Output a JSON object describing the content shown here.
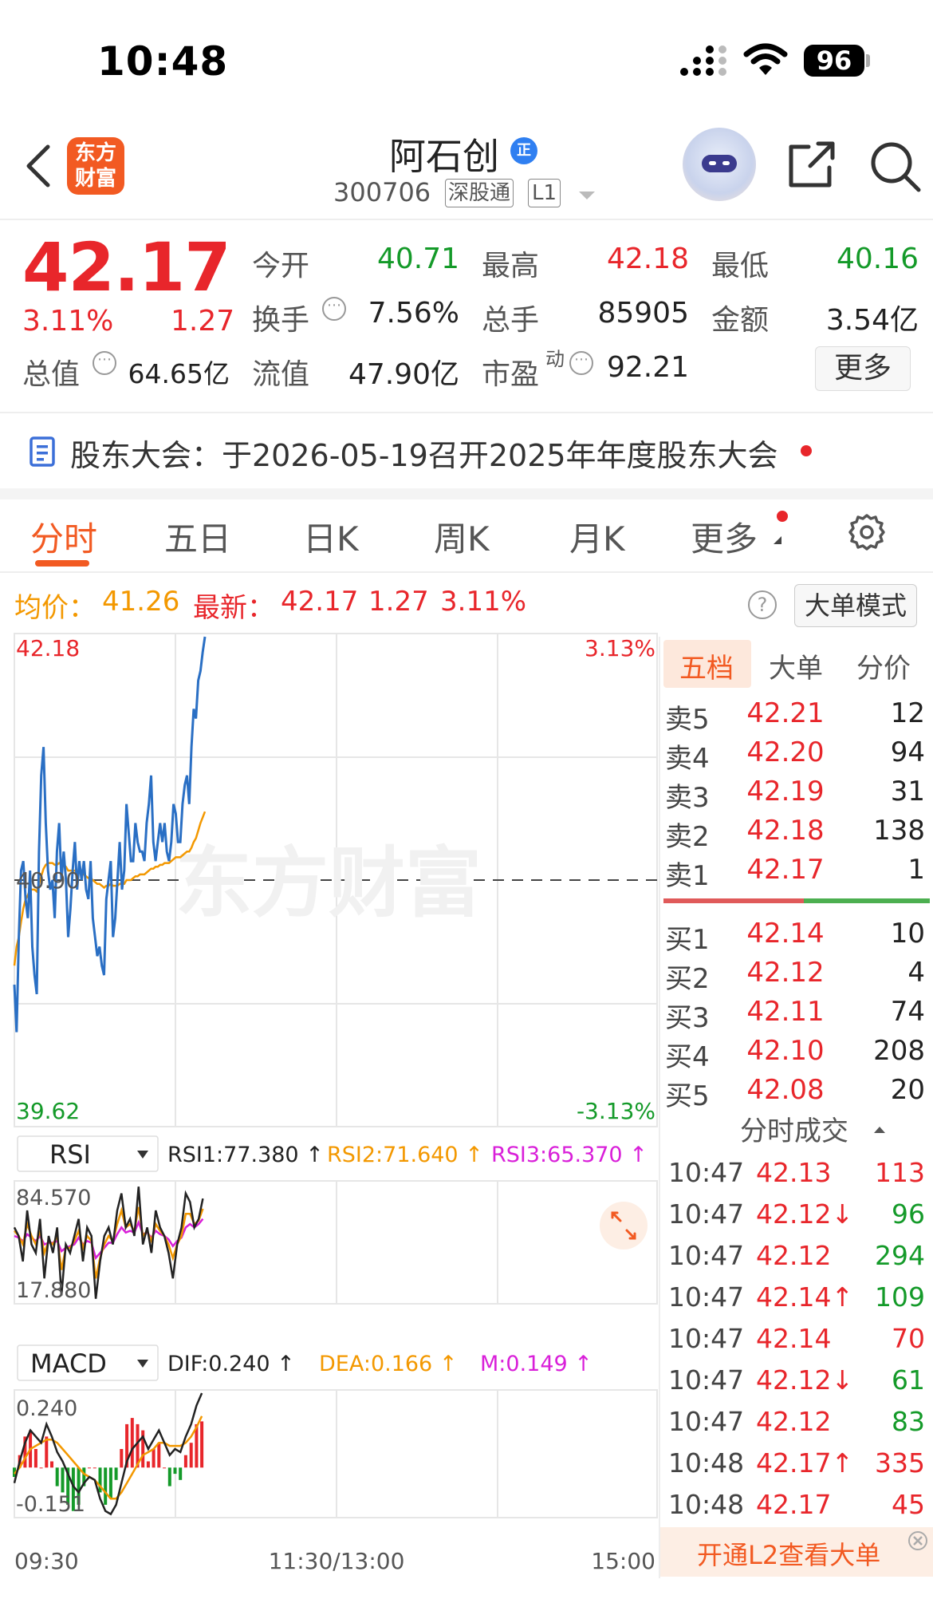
{
  "status": {
    "time": "10:48",
    "battery": "96"
  },
  "header": {
    "logo_line1": "东方",
    "logo_line2": "财富",
    "stock_name": "阿石创",
    "badge": "正",
    "code": "300706",
    "market": "深股通",
    "level": "L1"
  },
  "quote": {
    "price": "42.17",
    "change_pct": "3.11%",
    "change_amt": "1.27",
    "open_label": "今开",
    "open": "40.71",
    "high_label": "最高",
    "high": "42.18",
    "low_label": "最低",
    "low": "40.16",
    "turnover_label": "换手",
    "turnover": "7.56%",
    "volume_label": "总手",
    "volume": "85905",
    "amount_label": "金额",
    "amount": "3.54亿",
    "mktcap_label": "总值",
    "mktcap": "64.65亿",
    "float_label": "流值",
    "float": "47.90亿",
    "pe_label": "市盈",
    "pe_sup": "动",
    "pe": "92.21",
    "more": "更多"
  },
  "announcement": {
    "text": "股东大会：于2026-05-19召开2025年年度股东大会"
  },
  "tabs": [
    "分时",
    "五日",
    "日K",
    "周K",
    "月K",
    "更多"
  ],
  "avg_info": {
    "avg_label": "均价：",
    "avg": "41.26",
    "latest_label": "最新：",
    "latest": "42.17",
    "chg": "1.27",
    "pct": "3.11%",
    "mode_button": "大单模式"
  },
  "chart_data": {
    "type": "line",
    "x_axis_labels": [
      "09:30",
      "11:30/13:00",
      "15:00"
    ],
    "price_max": "42.18",
    "price_min": "39.62",
    "prev_close": "40.90",
    "pct_max": "3.13%",
    "pct_min": "-3.13%",
    "ylim": [
      39.62,
      42.18
    ],
    "colors": {
      "price": "#2a6fc4",
      "avg": "#f39800",
      "up": "#e8262b",
      "down": "#149a29"
    },
    "price_series": [
      40.35,
      40.1,
      40.6,
      40.95,
      41.0,
      40.8,
      40.7,
      40.95,
      40.55,
      40.4,
      40.3,
      41.05,
      41.45,
      41.6,
      41.2,
      40.95,
      40.85,
      40.9,
      40.7,
      41.05,
      41.2,
      40.9,
      41.05,
      40.9,
      40.6,
      40.75,
      40.95,
      41.1,
      40.85,
      41.0,
      40.9,
      41.0,
      40.85,
      40.8,
      41.0,
      40.7,
      40.6,
      40.5,
      40.55,
      40.45,
      40.4,
      40.8,
      40.9,
      41.0,
      40.6,
      40.7,
      40.9,
      41.1,
      40.85,
      40.95,
      41.3,
      41.15,
      41.0,
      41.0,
      41.2,
      41.1,
      41.05,
      41.05,
      41.0,
      41.2,
      41.3,
      41.45,
      41.1,
      41.0,
      41.1,
      41.2,
      41.1,
      41.2,
      41.05,
      41.0,
      41.1,
      41.3,
      41.25,
      41.1,
      41.1,
      41.3,
      41.4,
      41.45,
      41.3,
      41.6,
      41.8,
      41.75,
      41.95,
      42.0,
      42.1,
      42.18
    ],
    "avg_series": [
      40.45,
      40.55,
      40.6,
      40.68,
      40.75,
      40.8,
      40.82,
      40.85,
      40.85,
      40.85,
      40.84,
      40.88,
      40.92,
      40.96,
      40.98,
      40.99,
      40.99,
      40.99,
      40.98,
      40.98,
      40.99,
      40.98,
      40.98,
      40.97,
      40.95,
      40.95,
      40.95,
      40.95,
      40.94,
      40.94,
      40.93,
      40.93,
      40.92,
      40.91,
      40.91,
      40.9,
      40.89,
      40.88,
      40.88,
      40.87,
      40.86,
      40.87,
      40.87,
      40.88,
      40.87,
      40.87,
      40.87,
      40.88,
      40.88,
      40.88,
      40.9,
      40.9,
      40.9,
      40.91,
      40.92,
      40.92,
      40.93,
      40.93,
      40.93,
      40.94,
      40.95,
      40.96,
      40.96,
      40.97,
      40.97,
      40.98,
      40.98,
      40.99,
      40.99,
      40.99,
      41.0,
      41.01,
      41.02,
      41.02,
      41.02,
      41.03,
      41.04,
      41.05,
      41.05,
      41.07,
      41.1,
      41.12,
      41.16,
      41.2,
      41.23,
      41.26
    ],
    "rsi": {
      "selector": "RSI",
      "rsi1_label": "RSI1:77.380 ↑",
      "rsi2_label": "RSI2:71.640 ↑",
      "rsi3_label": "RSI3:65.370 ↑",
      "max": "84.570",
      "min": "17.880",
      "ylim": [
        17.88,
        84.57
      ],
      "rsi1": [
        60,
        55,
        40,
        70,
        50,
        45,
        65,
        30,
        55,
        45,
        60,
        20,
        50,
        45,
        55,
        65,
        40,
        60,
        55,
        18,
        40,
        55,
        60,
        50,
        70,
        80,
        60,
        65,
        55,
        84,
        50,
        60,
        45,
        70,
        60,
        55,
        45,
        30,
        50,
        60,
        80,
        75,
        60,
        65,
        77
      ],
      "rsi2": [
        58,
        55,
        50,
        62,
        55,
        50,
        58,
        45,
        52,
        50,
        55,
        35,
        48,
        48,
        52,
        58,
        48,
        55,
        52,
        30,
        42,
        50,
        55,
        52,
        62,
        70,
        60,
        62,
        58,
        72,
        55,
        58,
        52,
        62,
        58,
        55,
        50,
        42,
        50,
        55,
        68,
        68,
        62,
        64,
        71
      ],
      "rsi3": [
        55,
        54,
        52,
        56,
        54,
        52,
        55,
        50,
        51,
        51,
        52,
        46,
        48,
        49,
        50,
        54,
        50,
        52,
        51,
        42,
        45,
        48,
        51,
        51,
        56,
        60,
        57,
        58,
        57,
        63,
        56,
        57,
        54,
        58,
        56,
        55,
        53,
        49,
        52,
        54,
        60,
        62,
        60,
        62,
        65
      ]
    },
    "macd": {
      "selector": "MACD",
      "dif_label": "DIF:0.240 ↑",
      "dea_label": "DEA:0.166 ↑",
      "m_label": "M:0.149 ↑",
      "max": "0.240",
      "min": "-0.151",
      "ylim": [
        -0.151,
        0.24
      ],
      "dif": [
        -0.05,
        0.02,
        0.08,
        0.12,
        0.1,
        0.08,
        0.14,
        0.1,
        0.05,
        0.02,
        -0.02,
        -0.06,
        -0.08,
        -0.05,
        -0.03,
        -0.04,
        -0.1,
        -0.14,
        -0.15,
        -0.12,
        -0.05,
        0.02,
        0.06,
        0.08,
        0.1,
        0.06,
        0.09,
        0.12,
        0.08,
        0.04,
        0.06,
        0.05,
        0.1,
        0.14,
        0.2,
        0.24
      ],
      "dea": [
        -0.02,
        0.0,
        0.03,
        0.06,
        0.07,
        0.08,
        0.09,
        0.09,
        0.08,
        0.06,
        0.04,
        0.02,
        0.0,
        -0.02,
        -0.03,
        -0.04,
        -0.06,
        -0.08,
        -0.1,
        -0.1,
        -0.08,
        -0.05,
        -0.02,
        0.01,
        0.04,
        0.05,
        0.06,
        0.08,
        0.08,
        0.07,
        0.07,
        0.07,
        0.08,
        0.1,
        0.13,
        0.166
      ],
      "m": [
        -0.03,
        0.04,
        0.1,
        0.12,
        0.06,
        0.0,
        0.1,
        0.02,
        -0.06,
        -0.08,
        -0.12,
        -0.14,
        -0.12,
        -0.06,
        0.0,
        0.0,
        -0.08,
        -0.12,
        -0.1,
        -0.04,
        0.06,
        0.14,
        0.16,
        0.14,
        0.12,
        0.02,
        0.06,
        0.08,
        0.0,
        -0.06,
        -0.02,
        -0.04,
        0.04,
        0.08,
        0.14,
        0.149
      ]
    }
  },
  "order_book": {
    "tabs": [
      "五档",
      "大单",
      "分价"
    ],
    "asks": [
      {
        "label": "卖5",
        "price": "42.21",
        "vol": "12"
      },
      {
        "label": "卖4",
        "price": "42.20",
        "vol": "94"
      },
      {
        "label": "卖3",
        "price": "42.19",
        "vol": "31"
      },
      {
        "label": "卖2",
        "price": "42.18",
        "vol": "138"
      },
      {
        "label": "卖1",
        "price": "42.17",
        "vol": "1"
      }
    ],
    "bids": [
      {
        "label": "买1",
        "price": "42.14",
        "vol": "10"
      },
      {
        "label": "买2",
        "price": "42.12",
        "vol": "4"
      },
      {
        "label": "买3",
        "price": "42.11",
        "vol": "74"
      },
      {
        "label": "买4",
        "price": "42.10",
        "vol": "208"
      },
      {
        "label": "买5",
        "price": "42.08",
        "vol": "20"
      }
    ]
  },
  "trades": {
    "title": "分时成交",
    "rows": [
      {
        "time": "10:47",
        "price": "42.13",
        "vol": "113",
        "dir": "up"
      },
      {
        "time": "10:47",
        "price": "42.12↓",
        "vol": "96",
        "dir": "down"
      },
      {
        "time": "10:47",
        "price": "42.12",
        "vol": "294",
        "dir": "down"
      },
      {
        "time": "10:47",
        "price": "42.14↑",
        "vol": "109",
        "dir": "down"
      },
      {
        "time": "10:47",
        "price": "42.14",
        "vol": "70",
        "dir": "up"
      },
      {
        "time": "10:47",
        "price": "42.12↓",
        "vol": "61",
        "dir": "down"
      },
      {
        "time": "10:47",
        "price": "42.12",
        "vol": "83",
        "dir": "down"
      },
      {
        "time": "10:48",
        "price": "42.17↑",
        "vol": "335",
        "dir": "up"
      },
      {
        "time": "10:48",
        "price": "42.17",
        "vol": "45",
        "dir": "up"
      }
    ],
    "l2_banner": "开通L2查看大单"
  },
  "watermark": "东方财富"
}
